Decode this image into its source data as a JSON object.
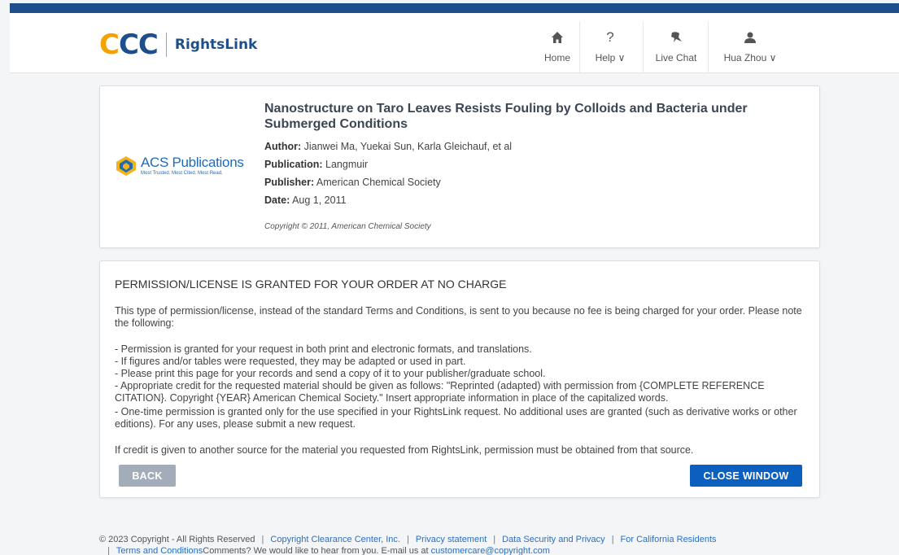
{
  "header": {
    "brand_ccc": "CCC",
    "brand_name": "RightsLink",
    "nav": [
      {
        "label": "Home",
        "icon": "home-icon"
      },
      {
        "label": "Help ∨",
        "icon": "question-icon"
      },
      {
        "label": "Live Chat",
        "icon": "chat-icon"
      },
      {
        "label": "Hua Zhou ∨",
        "icon": "user-icon"
      }
    ]
  },
  "article": {
    "publisher_logo": {
      "name": "ACS Publications",
      "tagline": "Most Trusted. Most Cited. Most Read."
    },
    "title": "Nanostructure on Taro Leaves Resists Fouling by Colloids and Bacteria under Submerged Conditions",
    "author_label": "Author:",
    "author": "Jianwei Ma, Yuekai Sun, Karla Gleichauf, et al",
    "publication_label": "Publication:",
    "publication": "Langmuir",
    "publisher_label": "Publisher:",
    "publisher": "American Chemical Society",
    "date_label": "Date:",
    "date": "Aug 1, 2011",
    "copyright": "Copyright © 2011, American Chemical Society"
  },
  "permission": {
    "heading": "PERMISSION/LICENSE IS GRANTED FOR YOUR ORDER AT NO CHARGE",
    "intro": "This type of permission/license, instead of the standard Terms and Conditions, is sent to you because no fee is being charged for your order. Please note the following:",
    "items": [
      "- Permission is granted for your request in both print and electronic formats, and translations.",
      "- If figures and/or tables were requested, they may be adapted or used in part.",
      "- Please print this page for your records and send a copy of it to your publisher/graduate school.",
      "- Appropriate credit for the requested material should be given as follows: \"Reprinted (adapted) with permission from {COMPLETE REFERENCE CITATION}. Copyright {YEAR} American Chemical Society.\" Insert appropriate information in place of the capitalized words.",
      "- One-time permission is granted only for the use specified in your RightsLink request. No additional uses are granted (such as derivative works or other editions). For any uses, please submit a new request."
    ],
    "credit_note": "If credit is given to another source for the material you requested from RightsLink, permission must be obtained from that source.",
    "back_label": "BACK",
    "close_label": "CLOSE WINDOW"
  },
  "footer": {
    "copyright": "© 2023 Copyright - All Rights Reserved",
    "links": [
      "Copyright Clearance Center, Inc.",
      "Privacy statement",
      "Data Security and Privacy",
      "For California Residents"
    ],
    "terms": "Terms and Conditions",
    "comments": "Comments? We would like to hear from you. E-mail us at",
    "email": "customercare@copyright.com"
  },
  "colors": {
    "brand_blue": "#1e4f8c",
    "brand_orange": "#f5a100",
    "button_blue": "#0b5fbf",
    "button_grey": "#a3adb9"
  }
}
